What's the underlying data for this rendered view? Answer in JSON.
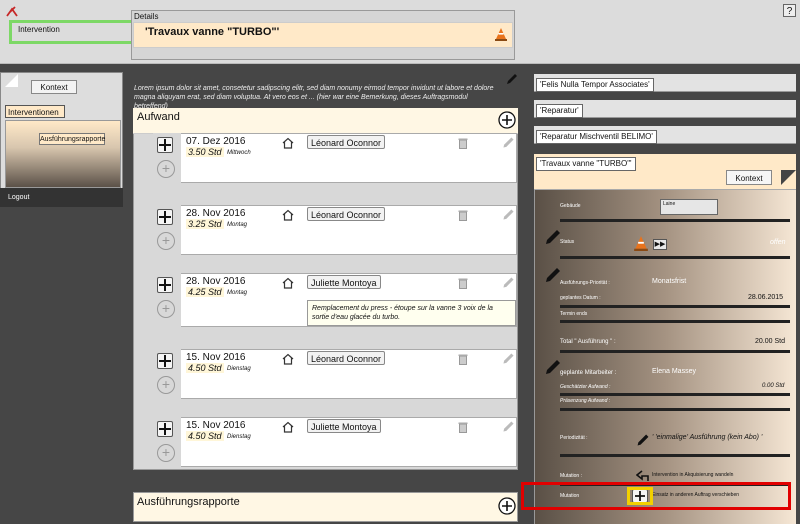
{
  "header": {
    "intervention_label": "Intervention",
    "details_label": "Details",
    "details_value": "'Travaux vanne \"TURBO\"'",
    "help": "?"
  },
  "left": {
    "kontext_button": "Kontext",
    "tab": "Interventionen",
    "ausfuehrung_button": "Ausführungsrapporte",
    "logout": "Logout"
  },
  "middle": {
    "remark": "Lorem ipsum dolor sit amet, consetetur sadipscing elitr, sed diam nonumy eirmod tempor invidunt ut labore et dolore magna aliquyam erat, sed diam voluptua. At vero eos et ... (hier war eine Bemerkung, dieses Auftragsmodul betreffend)",
    "aufwand_title": "Aufwand",
    "entries": [
      {
        "date": "07. Dez 2016",
        "hours": "3.50 Std",
        "day": "Mittwoch",
        "person": "Léonard Oconnor"
      },
      {
        "date": "28. Nov 2016",
        "hours": "3.25 Std",
        "day": "Montag",
        "person": "Léonard Oconnor"
      },
      {
        "date": "28. Nov 2016",
        "hours": "4.25 Std",
        "day": "Montag",
        "person": "Juliette Montoya",
        "comment": "Remplacement du press - étoupe sur la vanne 3 voix de la sortie d'eau glacée du turbo."
      },
      {
        "date": "15. Nov 2016",
        "hours": "4.50 Std",
        "day": "Dienstag",
        "person": "Léonard Oconnor"
      },
      {
        "date": "15. Nov 2016",
        "hours": "4.50 Std",
        "day": "Dienstag",
        "person": "Juliette Montoya"
      }
    ],
    "ausf_title": "Ausführungsrapporte"
  },
  "right": {
    "contexts": [
      "'Felis Nulla Tempor Associates'",
      "'Reparatur'",
      "'Reparatur Mischventil BELIMO'"
    ],
    "detail_title": "'Travaux vanne \"TURBO\"'",
    "kontext_button": "Kontext",
    "gebaeude_label": "Gebäude",
    "gebaeude_value": "Laine",
    "status_label": "Status",
    "status_value": "offen",
    "prio_label": "Ausführungs-Priorität :",
    "prio_value": "Monatsfrist",
    "datum_label": "geplantes Datum :",
    "datum_value": "28.06.2015",
    "termin_label": "Termin ends",
    "total_label": "Total \" Ausführung \" :",
    "total_value": "20.00 Std",
    "mitarbeiter_label": "geplante Mitarbeiter :",
    "mitarbeiter_value": "Elena Massey",
    "aufwand_label": "Geschätzter Aufwand :",
    "aufwand_value": "0.00 Std",
    "praesenz_label": "Präsenzung Aufwand :",
    "periodizitaet_label": "Periodizität :",
    "periodizitaet_value": "' 'einmalige' Ausführung (kein Abo) '",
    "mutation1_label": "Mutation :",
    "mutation1_value": "Intervention in Akquisierung wandeln",
    "mutation2_label": "Mutation",
    "mutation2_value": "Einsatz in anderen Auftrag verschieben"
  }
}
